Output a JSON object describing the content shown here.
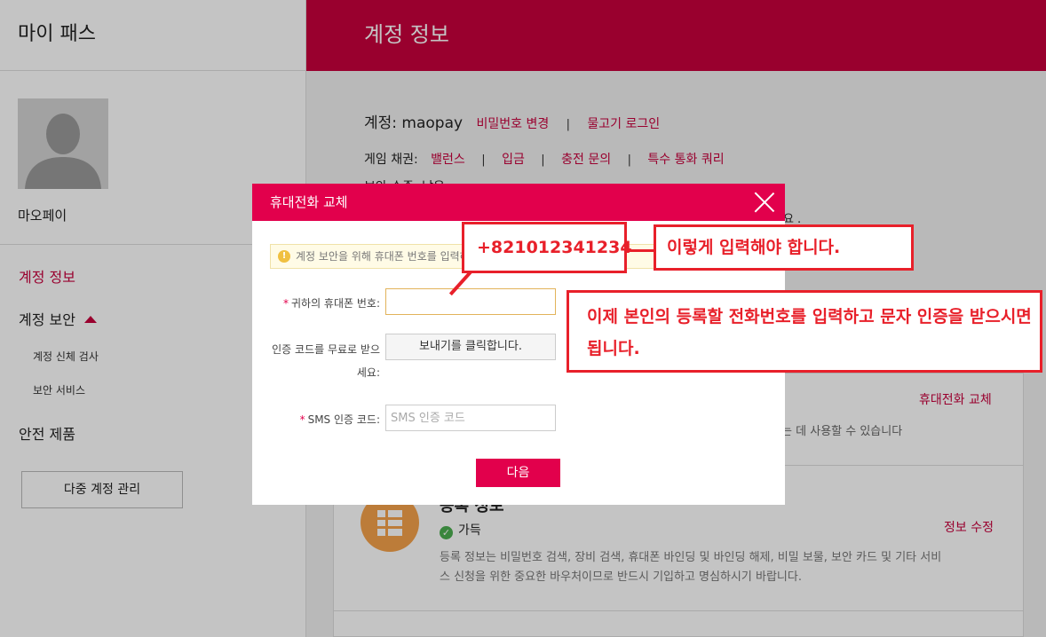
{
  "sidebar": {
    "title": "마이 패스",
    "username": "마오페이",
    "nav": {
      "account_info": "계정 정보",
      "account_security": "계정 보안",
      "security_checkup": "계정 신체 검사",
      "security_service": "보안 서비스",
      "safe_products": "안전 제품",
      "multi_account": "다중 계정 관리"
    }
  },
  "main": {
    "header": "계정 정보",
    "account_label": "계정: maopay",
    "change_password": "비밀번호 변경",
    "goldfish_login": "물고기 로그인",
    "bond_label": "게임 채권:",
    "balance": "밸런스",
    "deposit": "입금",
    "charge_inquiry": "충전 문의",
    "special_call_query": "특수 통화 쿼리",
    "partial_line1": "보안 수준: 낮음",
    "partial_line2": "세요 ."
  },
  "card": {
    "replace_phone_link": "휴대전화 교체",
    "replace_phone_desc_tail": "을 얻는 데 사용할 수 있습니다",
    "reg_title": "등록 정보",
    "reg_status": "가득",
    "edit_info": "정보 수정",
    "reg_desc": "등록 정보는 비밀번호 검색, 장비 검색, 휴대폰 바인딩 및 바인딩 해제, 비밀 보물, 보안 카드 및 기타 서비스 신청을 위한 중요한 바우처이므로 반드시 기입하고 명심하시기 바랍니다."
  },
  "modal": {
    "title": "휴대전화 교체",
    "notice": "계정 보안을 위해 휴대폰 번호를 입력하세요",
    "phone_label": "귀하의 휴대폰 번호:",
    "phone_value": "",
    "code_label": "인증 코드를 무료로 받으세요:",
    "send_button": "보내기를 클릭합니다.",
    "sms_label": "SMS 인증 코드:",
    "sms_placeholder": "SMS 인증 코드",
    "next_button": "다음"
  },
  "annotations": {
    "phone_example": "+821012341234",
    "enter_like_this": "이렇게 입력해야 합니다.",
    "instruction": "이제 본인의 등록할 전화번호를 입력하고 문자 인증을 받으시면 됩니다."
  },
  "colors": {
    "brand": "#c8003c",
    "modal_header": "#e2004c",
    "annotation_red": "#e8202a"
  }
}
